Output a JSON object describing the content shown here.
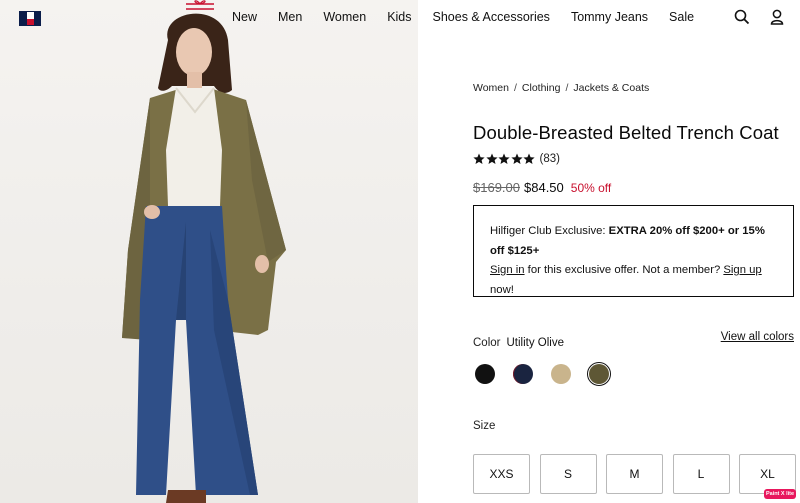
{
  "header": {
    "logo_icon": "tommy-hilfiger-flag-logo",
    "nav": [
      "New",
      "Men",
      "Women",
      "Kids",
      "Shoes & Accessories",
      "Tommy Jeans",
      "Sale"
    ],
    "search_icon": "search-icon",
    "account_icon": "user-icon"
  },
  "breadcrumb": {
    "items": [
      "Women",
      "Clothing",
      "Jackets & Coats"
    ],
    "separator": "/"
  },
  "product": {
    "title": "Double-Breasted Belted Trench Coat",
    "rating_stars": 5,
    "rating_count": "(83)",
    "price_original": "$169.00",
    "price_sale": "$84.50",
    "discount": "50% off"
  },
  "club": {
    "intro": "Hilfiger Club Exclusive: ",
    "offer": "EXTRA 20% off $200+ or 15% off $125+",
    "signin_link": "Sign in",
    "middle": " for this exclusive offer. Not a member? ",
    "signup_link": "Sign up",
    "end": " now!"
  },
  "color": {
    "label": "Color",
    "selected": "Utility Olive",
    "view_all": "View all colors",
    "swatches": [
      {
        "name": "black",
        "hex": "#111111"
      },
      {
        "name": "navy",
        "hex": "#1a2440"
      },
      {
        "name": "khaki",
        "hex": "#c9b48c"
      },
      {
        "name": "utility-olive",
        "hex": "#5e5735"
      }
    ]
  },
  "size": {
    "label": "Size",
    "options": [
      "XXS",
      "S",
      "M",
      "L",
      "XL"
    ]
  },
  "badge": "Paint X lite",
  "colors": {
    "accent_red": "#c8102e",
    "navy": "#0b1d4a"
  }
}
